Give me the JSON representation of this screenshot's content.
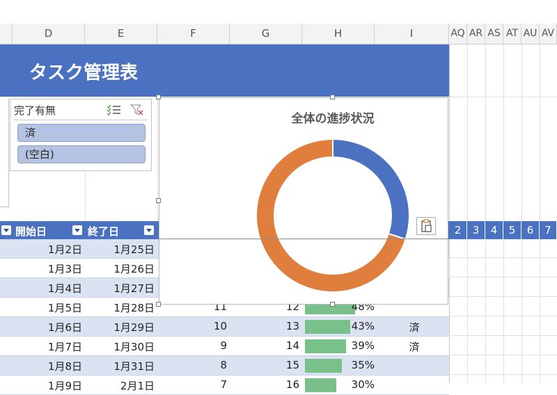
{
  "columns": {
    "left": [
      "D",
      "E",
      "F",
      "G",
      "H",
      "I"
    ],
    "right": [
      "AQ",
      "AR",
      "AS",
      "AT",
      "AU",
      "AV"
    ]
  },
  "sheet_title": "タスク管理表",
  "slicer": {
    "title": "完了有無",
    "items": [
      "済",
      "(空白)"
    ]
  },
  "table_headers": {
    "start": "開始日",
    "end": "終了日"
  },
  "day_numbers": [
    "2",
    "3",
    "4",
    "5",
    "6",
    "7"
  ],
  "rows": [
    {
      "start": "1月2日",
      "end": "1月25日",
      "f": "",
      "g": "",
      "pct_text": "",
      "progress": 0,
      "done": ""
    },
    {
      "start": "1月3日",
      "end": "1月26日",
      "f": "",
      "g": "",
      "pct_text": "",
      "progress": 0,
      "done": ""
    },
    {
      "start": "1月4日",
      "end": "1月27日",
      "f": "",
      "g": "",
      "pct_text": "",
      "progress": 0,
      "done": ""
    },
    {
      "start": "1月5日",
      "end": "1月28日",
      "f": "11",
      "g": "12",
      "pct_text": "48%",
      "progress": 0.48,
      "done": ""
    },
    {
      "start": "1月6日",
      "end": "1月29日",
      "f": "10",
      "g": "13",
      "pct_text": "43%",
      "progress": 0.43,
      "done": "済"
    },
    {
      "start": "1月7日",
      "end": "1月30日",
      "f": "9",
      "g": "14",
      "pct_text": "39%",
      "progress": 0.39,
      "done": "済"
    },
    {
      "start": "1月8日",
      "end": "1月31日",
      "f": "8",
      "g": "15",
      "pct_text": "35%",
      "progress": 0.35,
      "done": ""
    },
    {
      "start": "1月9日",
      "end": "2月1日",
      "f": "7",
      "g": "16",
      "pct_text": "30%",
      "progress": 0.3,
      "done": ""
    }
  ],
  "chart_data": {
    "type": "pie",
    "title": "全体の進捗状況",
    "categories": [
      "",
      ""
    ],
    "values": [
      30,
      70
    ],
    "colors": [
      "#4a72c0",
      "#e07f3d"
    ],
    "donut": true
  }
}
